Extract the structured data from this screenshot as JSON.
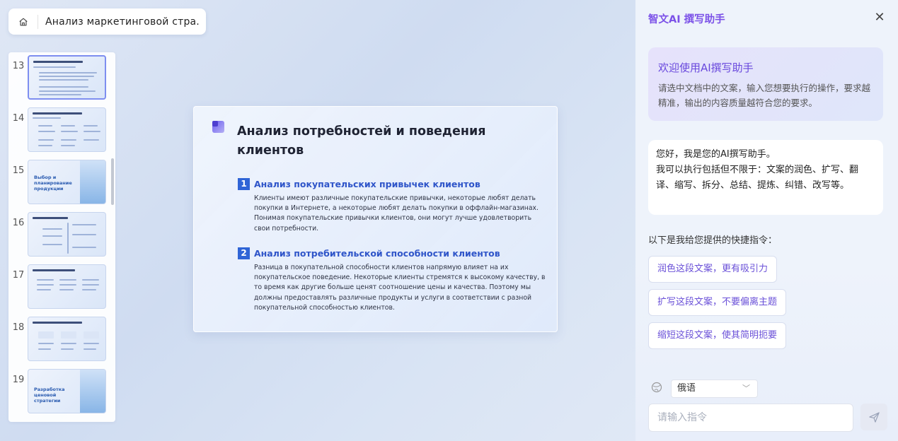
{
  "document": {
    "title": "Анализ маркетинговой стра..."
  },
  "thumbnails": [
    {
      "number": "13",
      "text": ""
    },
    {
      "number": "14",
      "text": ""
    },
    {
      "number": "15",
      "text": "Выбор и планирование продукции"
    },
    {
      "number": "16",
      "text": ""
    },
    {
      "number": "17",
      "text": ""
    },
    {
      "number": "18",
      "text": ""
    },
    {
      "number": "19",
      "text": "Разработка ценовой стратегии"
    }
  ],
  "slide": {
    "heading": "Анализ потребностей и поведения клиентов",
    "sections": [
      {
        "number": "1",
        "title": "Анализ покупательских привычек клиентов",
        "body": "Клиенты имеют различные покупательские привычки, некоторые любят делать покупки в Интернете, а некоторые любят делать покупки в оффлайн-магазинах. Понимая покупательские привычки клиентов, они могут лучше удовлетворить свои потребности."
      },
      {
        "number": "2",
        "title": "Анализ потребительской способности клиентов",
        "body": "Разница в покупательной способности клиентов напрямую влияет на их покупательское поведение. Некоторые клиенты стремятся к высокому качеству, в то время как другие больше ценят соотношение цены и качества. Поэтому мы должны предоставлять различные продукты и услуги в соответствии с разной покупательной способностью клиентов."
      }
    ]
  },
  "ai_panel": {
    "title": "智文AI 撰写助手",
    "welcome_title": "欢迎使用AI撰写助手",
    "welcome_text": "请选中文档中的文案，输入您想要执行的操作，要求越精准，输出的内容质量越符合您的要求。",
    "greeting": "您好，我是您的AI撰写助手。\n我可以执行包括但不限于：文案的润色、扩写、翻译、缩写、拆分、总结、提炼、纠错、改写等。",
    "shortcut_title": "以下是我给您提供的快捷指令：",
    "commands": [
      "润色这段文案，更有吸引力",
      "扩写这段文案，不要偏离主题",
      "缩短这段文案，使其简明扼要"
    ],
    "language": "俄语",
    "input_placeholder": "请输入指令"
  }
}
